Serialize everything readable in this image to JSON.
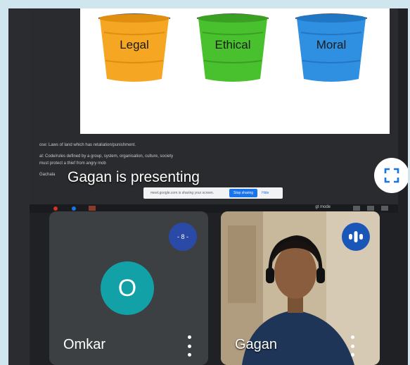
{
  "slide": {
    "buckets": [
      {
        "label": "Legal",
        "color": "#f5a623",
        "rim": "#e08e10"
      },
      {
        "label": "Ethical",
        "color": "#49c12e",
        "rim": "#3aa024"
      },
      {
        "label": "Moral",
        "color": "#2f8fe0",
        "rim": "#2277c4"
      }
    ],
    "notes": [
      "ose: Laws of land which has retaliation/punishment.",
      "al: Code/rules defined by a group, system, organisation, culture, society",
      "must protect a thief from angry mob",
      "Gachala"
    ]
  },
  "presenting_banner": "Gagan is presenting",
  "share_bar": {
    "message": "meet.google.com is sharing your screen.",
    "stop_label": "Stop sharing",
    "hide_label": "Hide"
  },
  "toolbar": {
    "mode_label": "gt mode"
  },
  "participants": [
    {
      "name": "Omkar",
      "initial": "O",
      "badge": "- 8 -",
      "avatar_color": "#13a1a8"
    },
    {
      "name": "Gagan"
    }
  ],
  "colors": {
    "accent": "#1a73e8",
    "speaking_badge": "#1a56b8",
    "muted_badge": "#2b4aa8"
  },
  "icons": [
    "fullscreen-icon",
    "more-vert-icon",
    "audio-level-icon"
  ]
}
